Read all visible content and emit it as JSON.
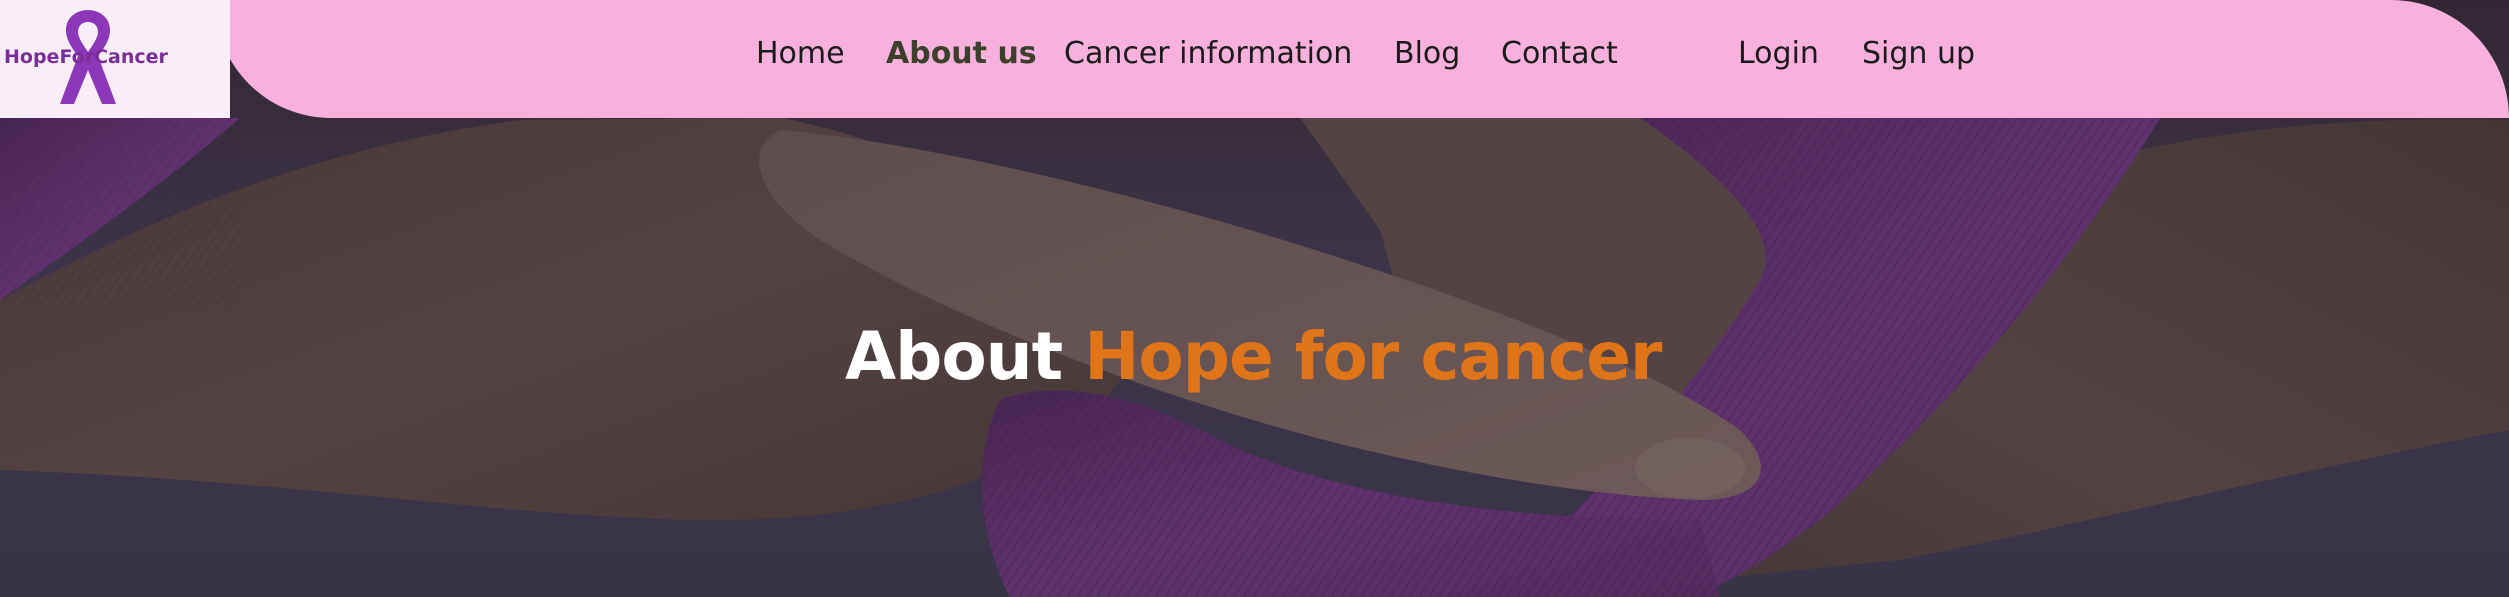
{
  "brand": {
    "name": "HopeForCancer",
    "logo_icon": "awareness-ribbon-icon"
  },
  "nav": {
    "items": [
      {
        "label": "Home",
        "active": false
      },
      {
        "label": "About us",
        "active": true
      },
      {
        "label": "Cancer information",
        "active": false
      },
      {
        "label": "Blog",
        "active": false
      },
      {
        "label": "Contact",
        "active": false
      }
    ],
    "auth": {
      "login": "Login",
      "signup": "Sign up"
    }
  },
  "hero": {
    "title_prefix": "About",
    "title_highlight": "Hope for cancer",
    "background_description_icon": "hands-holding-purple-ribbon-photo"
  },
  "colors": {
    "header_pink": "#f8b0dc",
    "logo_panel": "#f8eef8",
    "brand_purple": "#7a2d97",
    "ribbon_purple": "#8a3fa8",
    "highlight_orange": "#e07418",
    "active_nav": "#3c3f2a"
  }
}
